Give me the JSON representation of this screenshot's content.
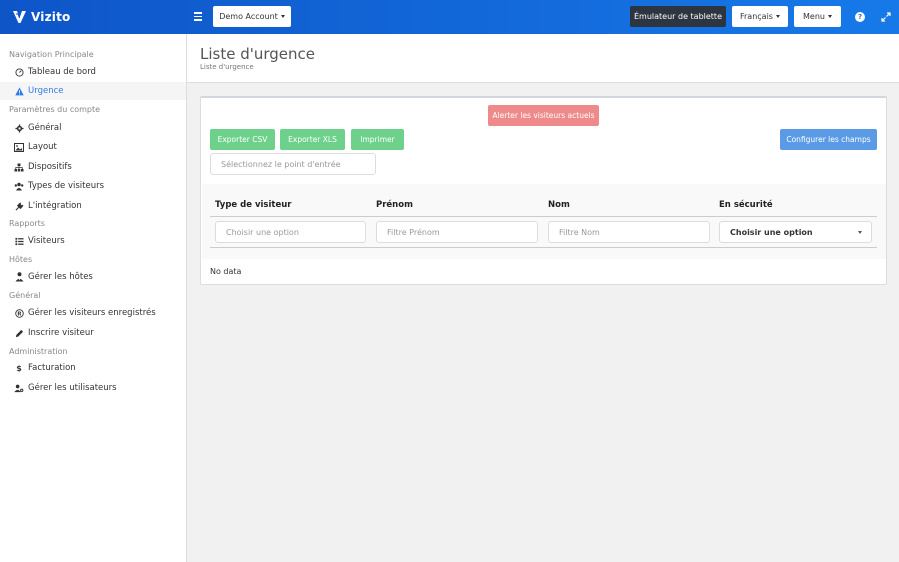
{
  "app": {
    "logo_text": "Vizito",
    "brand_color": "#1566d6"
  },
  "topbar": {
    "account_label": "Demo Account",
    "tablet_label": "Émulateur de tablette",
    "language_label": "Français",
    "menu_label": "Menu"
  },
  "sidebar": {
    "sections": [
      {
        "title": "Navigation Principale"
      },
      {
        "title": "Paramètres du compte"
      },
      {
        "title": "Rapports"
      },
      {
        "title": "Hôtes"
      },
      {
        "title": "Général"
      },
      {
        "title": "Administration"
      }
    ],
    "items": [
      {
        "label": "Tableau de bord",
        "icon": "dashboard-icon"
      },
      {
        "label": "Urgence",
        "icon": "warning-icon",
        "active": true
      },
      {
        "label": "Général",
        "icon": "gear-icon"
      },
      {
        "label": "Layout",
        "icon": "image-icon"
      },
      {
        "label": "Dispositifs",
        "icon": "sitemap-icon"
      },
      {
        "label": "Types de visiteurs",
        "icon": "users-icon"
      },
      {
        "label": "L'intégration",
        "icon": "plug-icon"
      },
      {
        "label": "Visiteurs",
        "icon": "list-icon"
      },
      {
        "label": "Gérer les hôtes",
        "icon": "user-tie-icon"
      },
      {
        "label": "Gérer les visiteurs enregistrés",
        "icon": "registered-icon"
      },
      {
        "label": "Inscrire visiteur",
        "icon": "pencil-icon"
      },
      {
        "label": "Facturation",
        "icon": "dollar-icon"
      },
      {
        "label": "Gérer les utilisateurs",
        "icon": "user-gear-icon"
      }
    ]
  },
  "page": {
    "title": "Liste d'urgence",
    "breadcrumb": "Liste d'urgence"
  },
  "panel": {
    "alert_button": "Alerter les visiteurs actuels",
    "export_csv": "Exporter CSV",
    "export_xls": "Exporter XLS",
    "print": "Imprimer",
    "configure_fields": "Configurer les champs",
    "entry_point_placeholder": "Sélectionnez le point d'entrée"
  },
  "table": {
    "columns": [
      {
        "header": "Type de visiteur",
        "filter_placeholder": "Choisir une option"
      },
      {
        "header": "Prénom",
        "filter_placeholder": "Filtre Prénom"
      },
      {
        "header": "Nom",
        "filter_placeholder": "Filtre Nom"
      },
      {
        "header": "En sécurité",
        "filter_value": "Choisir une option"
      }
    ],
    "empty_text": "No data"
  },
  "colors": {
    "red_button": "#ef8a8a",
    "green_button": "#6dd18b",
    "blue_button": "#5b9be6",
    "active_link": "#2c7be5"
  }
}
